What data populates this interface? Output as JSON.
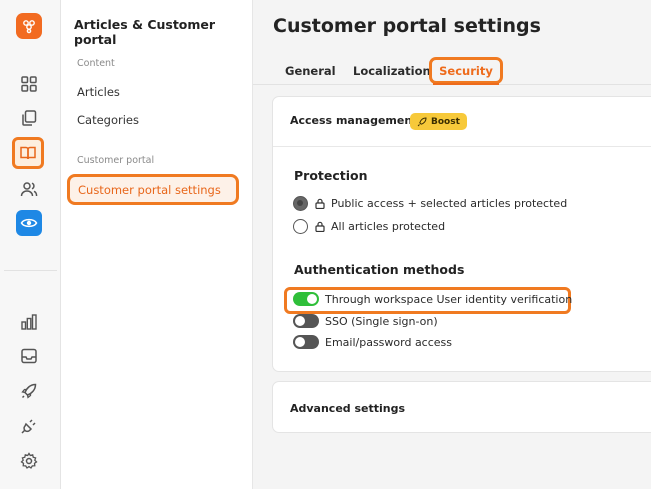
{
  "rail": {
    "icons": [
      "logo-icon",
      "grid-icon",
      "copy-icon",
      "book-icon",
      "users-icon",
      "eye-icon",
      "chart-icon",
      "inbox-icon",
      "rocket-icon",
      "plug-icon",
      "gear-icon"
    ],
    "accent": "#f07a21",
    "eye_color": "#1e88e5"
  },
  "sidebar": {
    "title": "Articles & Customer portal",
    "sections": [
      {
        "label": "Content",
        "items": [
          "Articles",
          "Categories"
        ]
      },
      {
        "label": "Customer portal",
        "items": [
          "Customer portal settings"
        ]
      }
    ]
  },
  "main": {
    "title": "Customer portal settings",
    "tabs": [
      {
        "label": "General"
      },
      {
        "label": "Localization"
      },
      {
        "label": "Security",
        "active": true
      }
    ],
    "access": {
      "title": "Access management",
      "badge": "Boost",
      "protection": {
        "heading": "Protection",
        "options": [
          {
            "label": "Public access + selected articles protected",
            "checked": true
          },
          {
            "label": "All articles protected",
            "checked": false
          }
        ]
      },
      "auth": {
        "heading": "Authentication methods",
        "options": [
          {
            "label": "Through workspace User identity verification",
            "on": true
          },
          {
            "label": "SSO (Single sign-on)",
            "on": false
          },
          {
            "label": "Email/password access",
            "on": false
          }
        ]
      }
    },
    "advanced": {
      "title": "Advanced settings"
    }
  }
}
